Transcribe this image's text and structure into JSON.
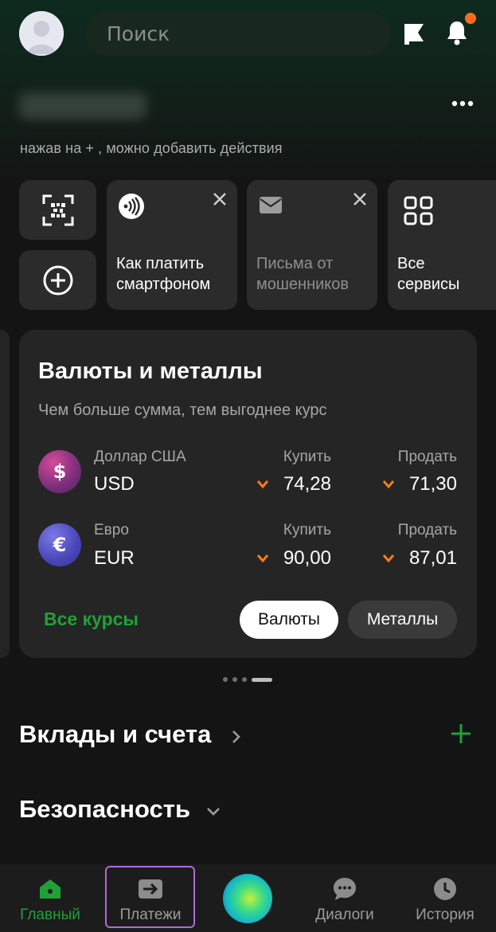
{
  "header": {
    "search_placeholder": "Поиск",
    "hint": "нажав на + , можно добавить действия",
    "notification_dot_color": "#ff6a1a"
  },
  "quick_actions": {
    "qr_icon": "qr-scan-icon",
    "add_icon": "plus-circle-icon",
    "stories": [
      {
        "label": "Как платить смартфоном",
        "icon": "nfc-pay-icon",
        "closable": true
      },
      {
        "label": "Письма от мошенников",
        "icon": "mail-icon",
        "closable": true
      },
      {
        "label": "Все сервисы",
        "icon": "grid-icon",
        "closable": false
      }
    ]
  },
  "currency_card": {
    "title": "Валюты и металлы",
    "subtitle": "Чем больше сумма, тем выгоднее курс",
    "buy_label": "Купить",
    "sell_label": "Продать",
    "rows": [
      {
        "name": "Доллар США",
        "code": "USD",
        "symbol": "$",
        "buy": "74,28",
        "sell": "71,30",
        "trend": "down"
      },
      {
        "name": "Евро",
        "code": "EUR",
        "symbol": "€",
        "buy": "90,00",
        "sell": "87,01",
        "trend": "down"
      }
    ],
    "all_rates": "Все курсы",
    "toggle": {
      "currencies": "Валюты",
      "metals": "Металлы",
      "selected": "Валюты"
    },
    "accent_color": "#21a038",
    "trend_color": "#ff7a1a"
  },
  "sections": {
    "deposits": "Вклады и счета",
    "security": "Безопасность"
  },
  "bottom_nav": {
    "home": "Главный",
    "payments": "Платежи",
    "dialogs": "Диалоги",
    "history": "История",
    "active": "Главный"
  }
}
